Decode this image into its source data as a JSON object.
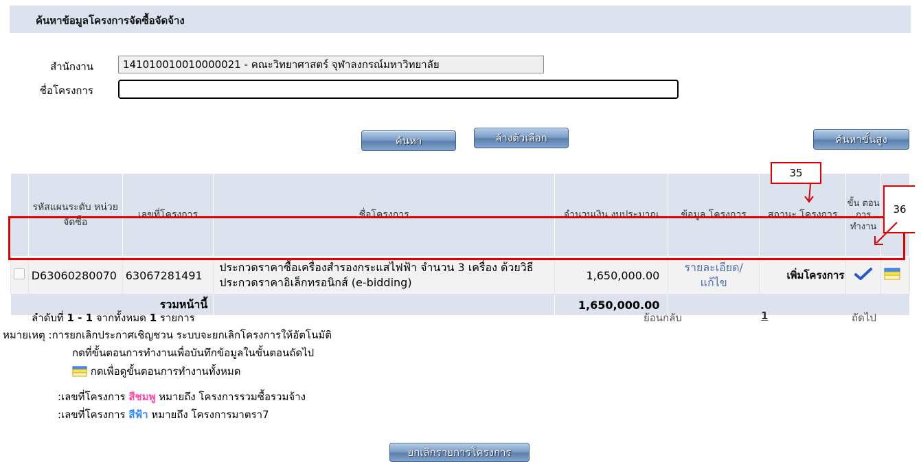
{
  "page": {
    "title": "ค้นหาข้อมูลโครงการจัดซื้อจัดจ้าง"
  },
  "form": {
    "office_label": "สำนักงาน",
    "office_value": "141010010010000021 - คณะวิทยาศาสตร์  จุฬาลงกรณ์มหาวิทยาลัย",
    "project_label": "ชื่อโครงการ",
    "project_value": ""
  },
  "buttons": {
    "search": "ค้นหา",
    "clear": "ล้างตัวเลือก",
    "advanced": "ค้นหาขั้นสูง",
    "cancel_project": "ยกเลิกรายการโครงการ"
  },
  "table": {
    "headers": {
      "plan_code": "รหัสแผนระดับ หน่วยจัดซื้อ",
      "project_no": "เลขที่โครงการ",
      "project_name": "ชื่อโครงการ",
      "budget": "จำนวนเงิน งบประมาณ",
      "info": "ข้อมูล โครงการ",
      "status": "สถานะ โครงการ",
      "step": "ขั้น ตอน การ ทำงาน"
    },
    "rows": [
      {
        "plan_code": "D63060280070",
        "project_no": "63067281491",
        "project_name": "ประกวดราคาซื้อเครื่องสำรองกระแสไฟฟ้า จำนวน 3 เครื่อง ด้วยวิธีประกวดราคาอิเล็กทรอนิกส์ (e-bidding)",
        "budget": "1,650,000.00",
        "info_link": "รายละเอียด/ แก้ไข",
        "status": "เพิ่มโครงการ"
      }
    ],
    "total_label": "รวมหน้านี้",
    "total_value": "1,650,000.00"
  },
  "pagination": {
    "summary_prefix": "ลำดับที่",
    "range": "1 - 1",
    "mid": "จากทั้งหมด",
    "count": "1",
    "suffix": "รายการ",
    "back": "ย้อนกลับ",
    "page": "1",
    "next": "ถัดไป"
  },
  "notes": {
    "line1": "หมายเหตุ :การยกเลิกประกาศเชิญชวน ระบบจะยกเลิกโครงการให้อัตโนมัติ",
    "line2": "กดที่ขั้นตอนการทำงานเพื่อบันทึกข้อมูลในขั้นตอนถัดไป",
    "line3": "กดเพื่อดูขั้นตอนการทำงานทั้งหมด",
    "line4_prefix": ":เลขที่โครงการ",
    "line4_color": "สีชมพู",
    "line4_suffix": "หมายถึง โครงการรวมซื้อรวมจ้าง",
    "line5_prefix": ":เลขที่โครงการ",
    "line5_color": "สีฟ้า",
    "line5_suffix": "หมายถึง โครงการมาตรา7"
  },
  "callouts": {
    "a": "35",
    "b": "36"
  },
  "colors": {
    "header_bg": "#dde3ee",
    "highlight": "#e00000",
    "link": "#4b70ad"
  }
}
